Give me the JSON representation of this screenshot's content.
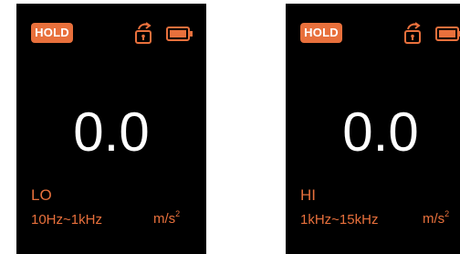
{
  "colors": {
    "accent": "#E8703C",
    "screen_background": "#000000",
    "reading_text": "#FFFFFF"
  },
  "screens": [
    {
      "hold_label": "HOLD",
      "reading": "0.0",
      "band": "LO",
      "frequency_range": "10Hz~1kHz",
      "unit_base": "m/s",
      "unit_exponent": "2",
      "icons": [
        "rotate-lock-icon",
        "battery-icon"
      ]
    },
    {
      "hold_label": "HOLD",
      "reading": "0.0",
      "band": "HI",
      "frequency_range": "1kHz~15kHz",
      "unit_base": "m/s",
      "unit_exponent": "2",
      "icons": [
        "rotate-lock-icon",
        "battery-icon"
      ]
    }
  ]
}
